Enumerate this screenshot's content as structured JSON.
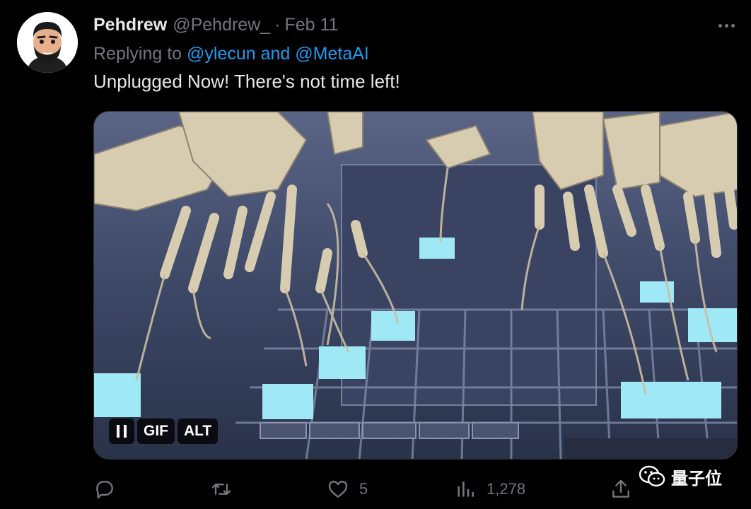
{
  "tweet": {
    "author_name": "Pehdrew",
    "author_handle": "@Pehdrew_",
    "separator": "·",
    "date": "Feb 11",
    "reply_prefix": "Replying to",
    "reply_targets": "@ylecun and @MetaAI",
    "text": "Unplugged Now! There's not time left!"
  },
  "media": {
    "gif_label": "GIF",
    "alt_label": "ALT"
  },
  "actions": {
    "reply_icon": "reply-icon",
    "retweet_icon": "retweet-icon",
    "like_icon": "heart-icon",
    "like_count": "5",
    "views_icon": "bar-chart-icon",
    "views_count": "1,278",
    "share_icon": "share-icon"
  },
  "watermark": {
    "text": "量子位"
  },
  "colors": {
    "background": "#000000",
    "text_primary": "#e7e9ea",
    "text_secondary": "#71767b",
    "link": "#1d9bf0"
  }
}
